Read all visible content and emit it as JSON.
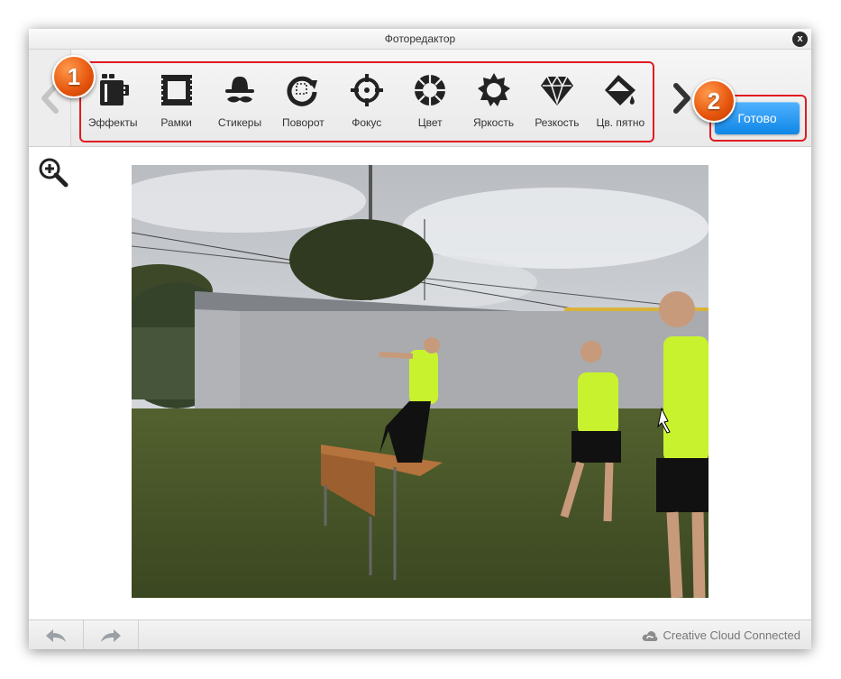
{
  "window": {
    "title": "Фоторедактор",
    "close_label": "x"
  },
  "toolbar": {
    "tools": [
      {
        "label": "Эффекты",
        "icon": "film-effects-icon"
      },
      {
        "label": "Рамки",
        "icon": "frame-icon"
      },
      {
        "label": "Стикеры",
        "icon": "mustache-hat-sticker-icon"
      },
      {
        "label": "Поворот",
        "icon": "rotate-icon"
      },
      {
        "label": "Фокус",
        "icon": "focus-crosshair-icon"
      },
      {
        "label": "Цвет",
        "icon": "color-wheel-icon"
      },
      {
        "label": "Яркость",
        "icon": "brightness-sun-icon"
      },
      {
        "label": "Резкость",
        "icon": "sharpness-diamond-icon"
      },
      {
        "label": "Цв. пятно",
        "icon": "color-splash-bucket-icon"
      }
    ],
    "done_label": "Готово"
  },
  "annotations": {
    "badge_1": "1",
    "badge_2": "2"
  },
  "status": {
    "cloud_text": "Creative Cloud Connected"
  },
  "colors": {
    "accent_blue": "#1f94f0",
    "highlight_red": "#e11b22",
    "badge_orange": "#e6540c"
  }
}
